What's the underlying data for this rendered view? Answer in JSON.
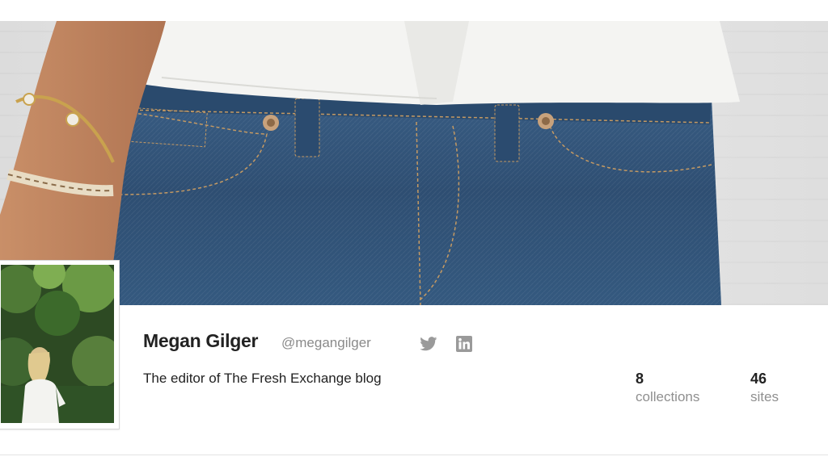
{
  "profile": {
    "name": "Megan Gilger",
    "handle": "@megangilger",
    "bio": "The editor of The Fresh Exchange blog"
  },
  "social": {
    "twitter_icon": "twitter-icon",
    "linkedin_icon": "linkedin-icon"
  },
  "stats": [
    {
      "value": "8",
      "label": "collections"
    },
    {
      "value": "46",
      "label": "sites"
    }
  ],
  "colors": {
    "name_text": "#222222",
    "muted_text": "#8a8a8a",
    "icon_gray": "#9a9a9a",
    "denim": "#2f4f72",
    "shirt": "#f4f4f2"
  }
}
